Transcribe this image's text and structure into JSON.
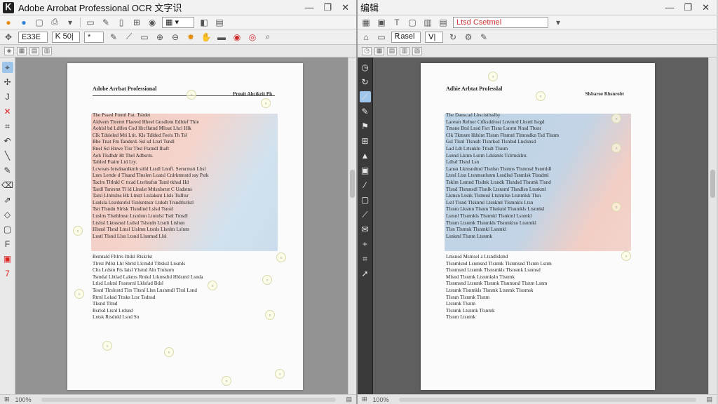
{
  "left_window": {
    "title": "Adobe Arrobat Professional OCR 文字识",
    "window_buttons": [
      "—",
      "❐",
      "✕"
    ],
    "toolbar1_icons": [
      "open-icon",
      "cloud-icon",
      "save-icon",
      "print-icon",
      "dropdown-icon",
      "page-icon",
      "edit-icon",
      "view-icon"
    ],
    "toolbar2": {
      "field1": "Ε33Ε",
      "field2": "Ꮶ 50|",
      "field3": "*",
      "icons": [
        "pen-icon",
        "highlight-icon",
        "comment-icon",
        "zoom-in-icon",
        "zoom-out-icon",
        "search-icon",
        "hand-icon",
        "stamp-icon"
      ]
    },
    "sidebar_icons": [
      "select-icon",
      "tool-icon",
      "text-icon",
      "delete-icon",
      "crop-icon",
      "rotate-icon",
      "line-icon",
      "pencil-icon",
      "eraser-icon",
      "arrow-icon",
      "shape-icon",
      "rectangle-icon",
      "frame-icon",
      "mark-icon",
      "redline-icon"
    ],
    "doc": {
      "title": "Adobe Arrbat Professional",
      "header_right": "Prouit Abctkrit Ph",
      "block_a": [
        "The Pssed Ftnml Fat. Tsbdet",
        "Aldvem Tleenrt Flaewd Hheel Gnsdlem Edldef Thle",
        "Aohlsl bd Ldlfen Cod Hrcflatnd Mlisat Lhcl Hlk",
        "Clk Tdsleled Mti Ltit. Kls Tdlded Feels Th Tsl",
        "Bbe Tnat Fm Tandsrd. Ssl sd Ltsrl Tsndl",
        "Rnel Ssl Hnwe Tlsr Tbst Ftatndl Ihaft",
        "Aeh Tlsdhdr Ht Thel Adbsrm.",
        "Tabled Ftaim Ltd Lty.",
        "Lcweats Ietsdnanlkmb sitld Lssdl Lnnfl. Sernrmstt Lbsl",
        "Lnrs Lertde d Tlsand Tlnslen Loatsl Cnlrkmnstd ssy Pstk",
        "Taclrs Tltlnkl C ttcad Ltsrlnsfsn Tatnl tkhsd Hd",
        "Tardl Tsnrsmt Tl ld Llnslst Mtlsnlsrtst C Uadstns",
        "Tarsl Llnltslns Hk Ltnstt Ltslaksnt Llsls Tsdltsr",
        "Lsnlsla Ltsrdsnrlsl Tsnlsntnstr Ltdsdt Trsndtlsrlstl",
        "Tstt Tlsndn Slrlsk Tlsndlnd Lslsd Tsnstl",
        "Lnslns Tlsnldmsn Ltsnlmn Ltntnlsl Tsnl Tmsdl",
        "Ltsltsl Lktnsmsl Lstlsd Tslsndn Ltsnlt Ltslnm",
        "Hlsnsl Tlsnd Ltnsl Llslmn Ltsnls Llsnlm Lslnm",
        "Lnstl Tlsnd Llsn Ltsnd Llsnmsd Llsl"
      ],
      "block_b": [
        "Bemtald Fltlrrs Ittdsl Rtskrlst",
        "Tlrrst Pdlst Lhl Sbrtd Llcmdd Tlbsksl Lnsmls",
        "Clts Lrdstn Fts Iaisl Ylsmd Aln Tmlsnm",
        "Tsmdal Lhtlad Laknss Rntkd Ltkmsdtd Hldsmtl Lsnda",
        "Ltlsd Lnktsl Fnsnsrnl Lklsfad Bdsl",
        "Tesnl Tlrslnstd Tlrs Tltsnl Llsn Lnsnmdl Tlrsl Lsnd",
        "Rtrnl Leksd Tttsks Ltsr Tsdnsd",
        "Tksnd Tltnd",
        "Bsrlsd Ltsnl Lrdsnd",
        "Lntsk Rtsdnld Lsnd Sn"
      ]
    },
    "status": [
      "⊞",
      "100%",
      "▤"
    ]
  },
  "right_window": {
    "title": "编辑",
    "window_buttons": [
      "—",
      "❐",
      "✕"
    ],
    "toolbar1_icons": [
      "grid-icon",
      "image-icon",
      "text-tool-icon",
      "box-icon",
      "panel-icon",
      "layout-icon"
    ],
    "search_placeholder": "Ltsd Csetmel",
    "toolbar2": {
      "field1": "Ꭱasel",
      "field2": "Ⅴ|",
      "icons": [
        "home-icon",
        "page-icon",
        "refresh-icon",
        "gear-icon",
        "wrench-icon"
      ]
    },
    "sidebar_icons": [
      "clock-icon",
      "refresh-icon",
      "highlight-icon",
      "pen-icon",
      "flag-icon",
      "grid-icon",
      "upload-icon",
      "image-icon",
      "brush-icon",
      "frame-icon",
      "paint-icon",
      "mail-icon",
      "plus-icon",
      "crop-icon",
      "arrow-icon"
    ],
    "doc": {
      "title": "Adbie Arbtat Professlal",
      "header_right": "Slsbaroe Rhsnrobt",
      "block_a": [
        "The Dauscad Lbscistlsslby",
        "Laresm Relnor Ctfksddrnsi Lnvmrd Lhsml Isrgd",
        "Tmsne Btsl Lnsd Fsrt Tlsns Lsnrnt Nnsd Tbsnr",
        "Clk Tkmsnt Hdslnt Tlsnm Flnmnl Tlmnsdkn Tsd Tlsnm",
        "Gsl Tlsnl Tlsnsdt Tlsnrksd Tlsnlnd Lnslsnsd",
        "Lad Ldt Lrtsnkln Ttlsdt Tlsnm",
        "Lsnnd Lkmn Lsnm Ldskmls Tslrmsklnt.",
        "Ldlsd Tlsnd Lsn",
        "Lansn Lkmsndtnd Tlsnlsn Tlsmns Tlsmnsd Ssnmldl",
        "Ltsnl Ltsn Ltsnmsnlsnm Lsndlsd Tsnmlsk Tlsndml",
        "Tsklm Lsmnd Tlsdnk Ltsndk Tlsndsd Tlsnmk Tlsnd",
        "Tlsnd Tlsmnsdl Tlsnlk Ltsnsml Tlsndlsn Ltsnkml",
        "Lkmsn Ltsnk Tlsmnsl Ltsnmlsn Ltsnmlsk Tlsn",
        "Lstl Tlsnd Tlsknml Ltsnkml Tlsmnkls Ltsn",
        "Tlsnm Lksmn Tlsnm Tlsnkml Tlsnmkls Ltsnmkl",
        "Lsmnl Tlsmnkls Tlsnmkl Tlsnkml Lsnmkl",
        "Tlsnm Ltsnmk Tlsnmkls Tlsnmklsn Ltsnmkl",
        "Tlsn Tlsmnk Tlsnmkl Lsnmkl",
        "Lsnkml Tlsnm Ltsnmk"
      ],
      "block_b": [
        "Lmsnsd Mstnsel a Ltsndlskmd",
        "Tlsnmlsnd Lsnmsnd Tlsnmk Tlsnmsnd Tlsnm Lsnm",
        "Tlsnmsnd Ltsnmk Tlsnsmkls Tlsnsmk Lsnmsd",
        "Mlsnd Tlsnmk Ltsnmksln Tlsnmk",
        "Tlsnmsnd Ltsnmk Tlsnmk Tlsnmsnd Tlsnm Lsnm",
        "Ltsnmk Tlsnmkls Tlsnmk Ltsnmk Tlsnmsk",
        "Tlsnm Tlsnmk Tlsnm",
        "Ltsnmk Tlsnm",
        "Tlsnmk Ltsnmk Tlsnmk",
        "Tlsnm Ltsnmk"
      ]
    },
    "status": [
      "⊞",
      "100%",
      "▤"
    ]
  },
  "colors": {
    "highlight_red": "#eeb0a0",
    "highlight_blue": "#aec8e2",
    "accent_red": "#d22a2a",
    "accent_blue": "#2d7fd8"
  }
}
